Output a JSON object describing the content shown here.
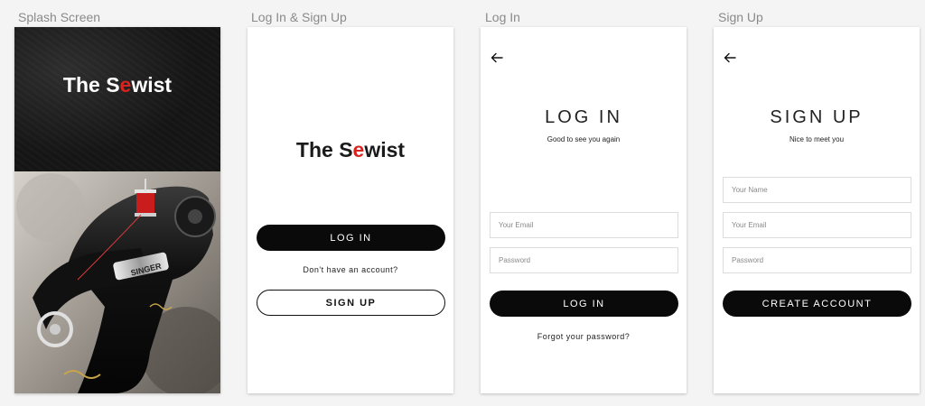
{
  "labels": {
    "splash": "Splash Screen",
    "welcome": "Log In & Sign Up",
    "login": "Log In",
    "signup": "Sign Up"
  },
  "brand": {
    "before": "The S",
    "accent": "e",
    "after": "wist",
    "accent_color": "#d8231f"
  },
  "welcome": {
    "login_button": "LOG IN",
    "prompt": "Don't have an account?",
    "signup_button": "SIGN UP"
  },
  "login": {
    "title": "LOG IN",
    "subtitle": "Good to see you again",
    "email_placeholder": "Your Email",
    "password_placeholder": "Password",
    "button": "LOG IN",
    "forgot": "Forgot your password?"
  },
  "signup": {
    "title": "SIGN UP",
    "subtitle": "Nice to meet you",
    "name_placeholder": "Your Name",
    "email_placeholder": "Your Email",
    "password_placeholder": "Password",
    "button": "CREATE ACCOUNT"
  },
  "icons": {
    "back": "arrow-left-icon"
  }
}
